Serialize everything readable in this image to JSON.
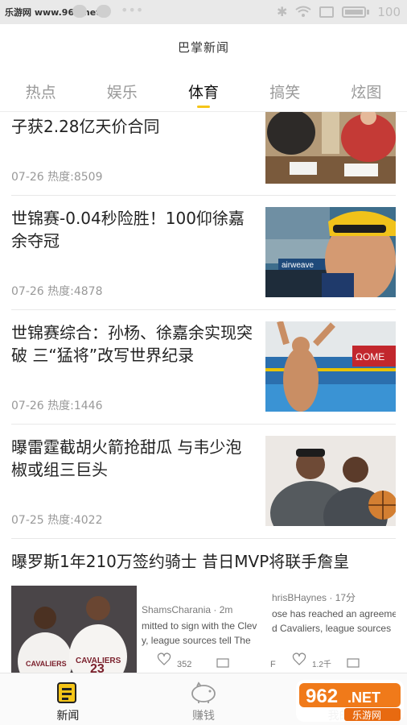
{
  "statusbar": {
    "site": "乐游网 www.962.net",
    "battery": "100"
  },
  "app": {
    "title": "巴掌新闻"
  },
  "tabs": [
    {
      "label": "热点"
    },
    {
      "label": "娱乐"
    },
    {
      "label": "体育"
    },
    {
      "label": "搞笑"
    },
    {
      "label": "炫图"
    }
  ],
  "feed": {
    "items": [
      {
        "title": "子获2.28亿天价合同",
        "meta": "07-26  热度:8509"
      },
      {
        "title": "世锦赛-0.04秒险胜！100仰徐嘉余夺冠",
        "meta": "07-26  热度:4878"
      },
      {
        "title": "世锦赛综合：孙杨、徐嘉余实现突破 三“猛将”改写世界纪录",
        "meta": "07-26  热度:1446"
      },
      {
        "title": "曝雷霆截胡火箭抢甜瓜 与韦少泡椒或组三巨头",
        "meta": "07-25  热度:4022"
      },
      {
        "title": "曝罗斯1年210万签约骑士 昔日MVP将联手詹皇"
      }
    ],
    "tweet": {
      "user1": "ShamsCharania · 2m",
      "line1a": "mitted to sign with the Clev",
      "line1b": "y, league sources tell The",
      "likes1": "352",
      "user2": "hrisBHaynes · 17分",
      "line2a": "ose has reached an agreeme",
      "line2b": "d Cavaliers, league sources",
      "likes2": "1.2千",
      "jersey_team": "CAVALIERS",
      "jersey_number": "23"
    },
    "thumb_texts": {
      "swim_banner": "airweave",
      "omega": "ΩOME"
    }
  },
  "bottomnav": [
    {
      "label": "新闻"
    },
    {
      "label": "赚钱"
    },
    {
      "label": "我的"
    }
  ],
  "watermark": {
    "brand": "962",
    "suffix": ".NET",
    "sub": "乐游网"
  }
}
